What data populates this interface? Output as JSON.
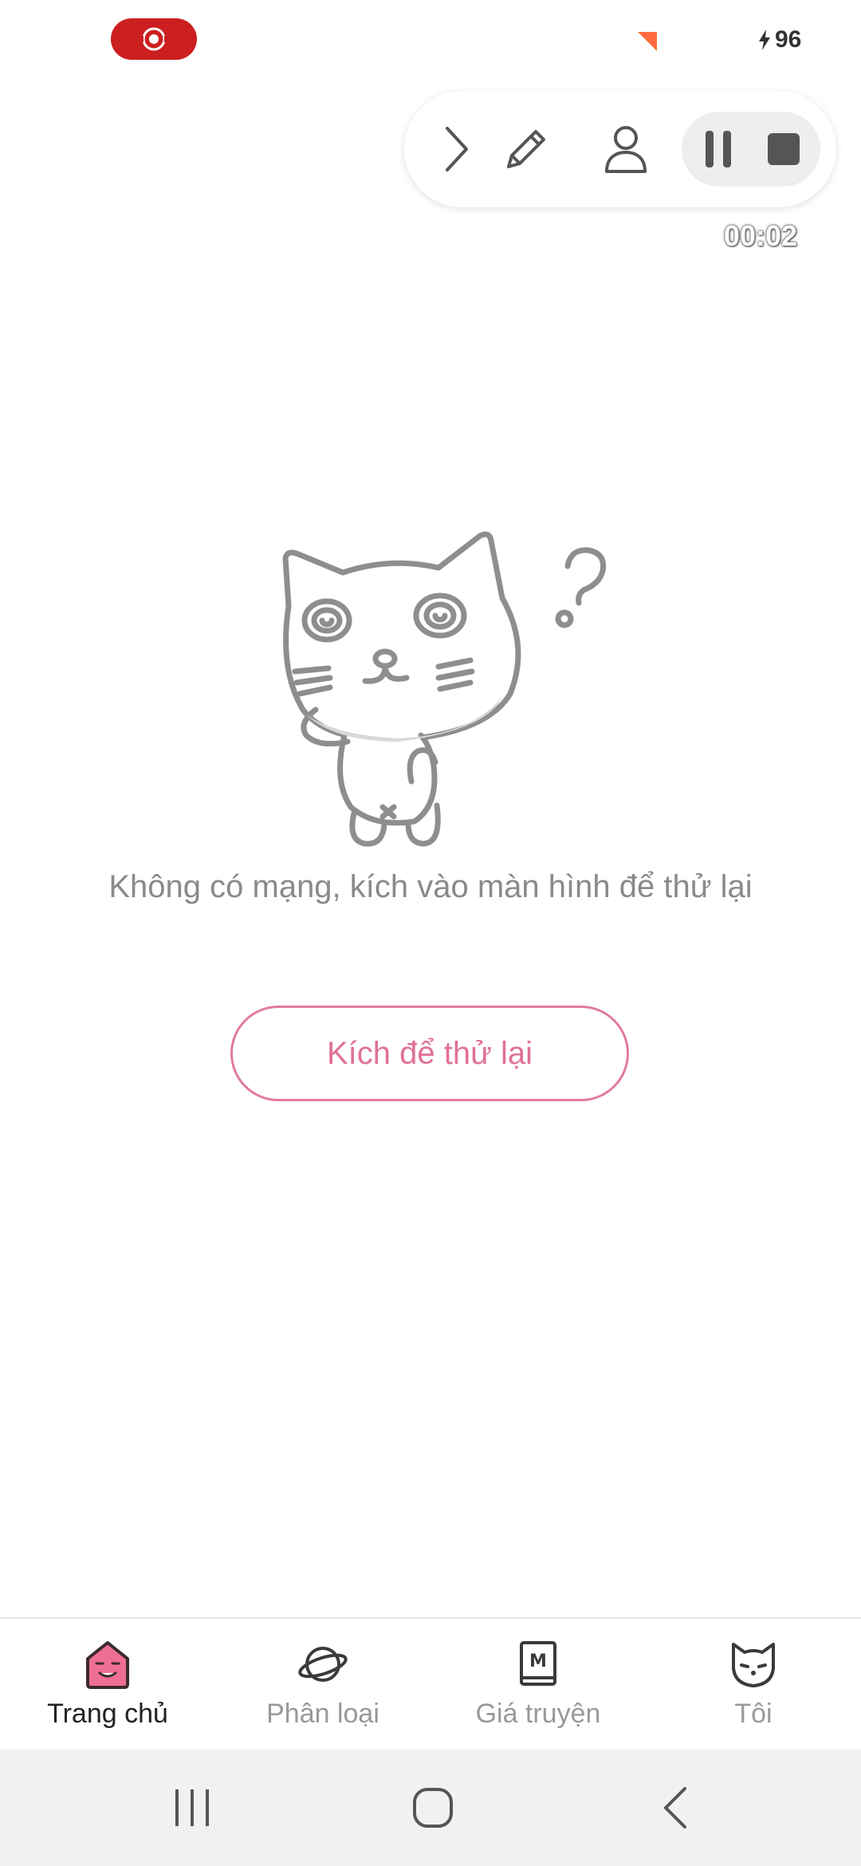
{
  "status_bar": {
    "battery_level": "96",
    "record_color": "#cc1f1f",
    "icons": [
      "screen-record-icon",
      "notification-flag-icon",
      "charging-bolt-icon"
    ]
  },
  "recorder": {
    "timer": "00:02",
    "buttons": [
      "expand-arrow-icon",
      "pen-icon",
      "person-icon",
      "pause-icon",
      "stop-icon"
    ]
  },
  "main": {
    "error_message": "Không có mạng, kích vào màn hình để thử lại",
    "retry_label": "Kích để thử lại",
    "accent_color": "#e0709a"
  },
  "bottom_nav": {
    "items": [
      {
        "label": "Trang chủ",
        "icon": "home-icon",
        "active": true
      },
      {
        "label": "Phân loại",
        "icon": "planet-icon",
        "active": false
      },
      {
        "label": "Giá truyện",
        "icon": "book-icon",
        "active": false
      },
      {
        "label": "Tôi",
        "icon": "cat-face-icon",
        "active": false
      }
    ]
  },
  "system_nav": {
    "buttons": [
      "recents-icon",
      "home-button-icon",
      "back-icon"
    ]
  }
}
